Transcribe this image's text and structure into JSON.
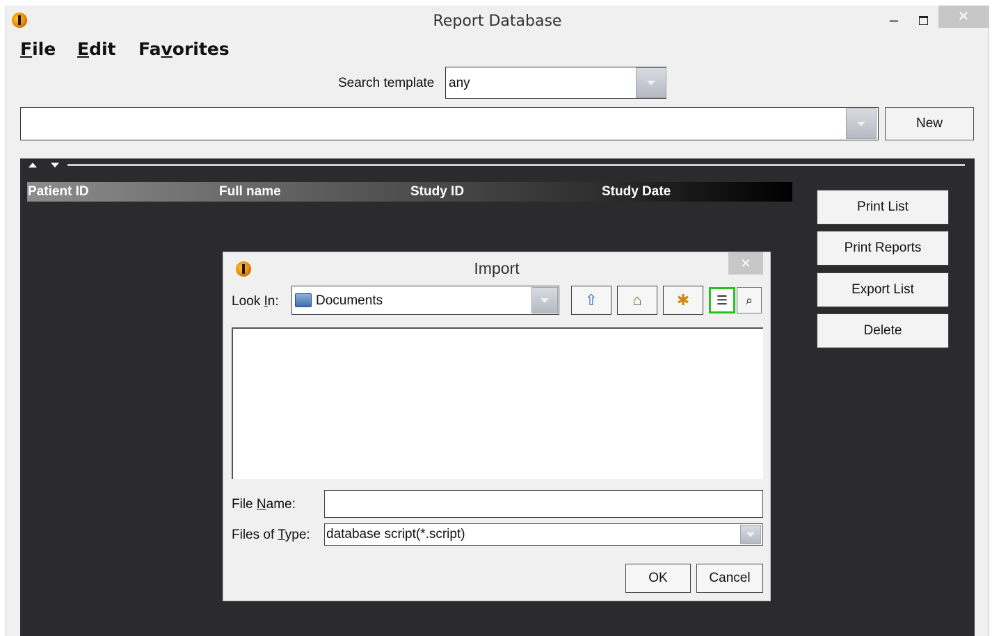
{
  "window": {
    "title": "Report Database",
    "minimize_glyph": "–",
    "close_glyph": "✕"
  },
  "menu": {
    "file": {
      "pre": "",
      "mnemonic": "F",
      "post": "ile"
    },
    "edit": {
      "pre": "",
      "mnemonic": "E",
      "post": "dit"
    },
    "favorites": {
      "pre": "Fa",
      "mnemonic": "v",
      "post": "orites"
    }
  },
  "search": {
    "label": "Search template",
    "value": "any"
  },
  "query": {
    "value": "",
    "new_label": "New"
  },
  "table": {
    "columns": [
      "Patient ID",
      "Full name",
      "Study ID",
      "Study Date"
    ],
    "rows": []
  },
  "actions": [
    "Print List",
    "Print Reports",
    "Export List",
    "Delete"
  ],
  "import_dialog": {
    "title": "Import",
    "close_glyph": "✕",
    "look_in": {
      "pre": "Look ",
      "mnemonic": "I",
      "post": "n:"
    },
    "look_in_value": "Documents",
    "file_name_label": {
      "pre": "File ",
      "mnemonic": "N",
      "post": "ame:"
    },
    "file_name_value": "",
    "files_of_type_label": {
      "pre": "Files of ",
      "mnemonic": "T",
      "post": "ype:"
    },
    "files_of_type_value": "database script(*.script)",
    "ok_label": "OK",
    "cancel_label": "Cancel",
    "icons": [
      "up-folder-icon",
      "home-icon",
      "new-folder-icon",
      "list-view-icon",
      "details-view-icon"
    ]
  },
  "colors": {
    "panel_bg": "#2b2b2d",
    "selected_view_border": "#22c422"
  }
}
